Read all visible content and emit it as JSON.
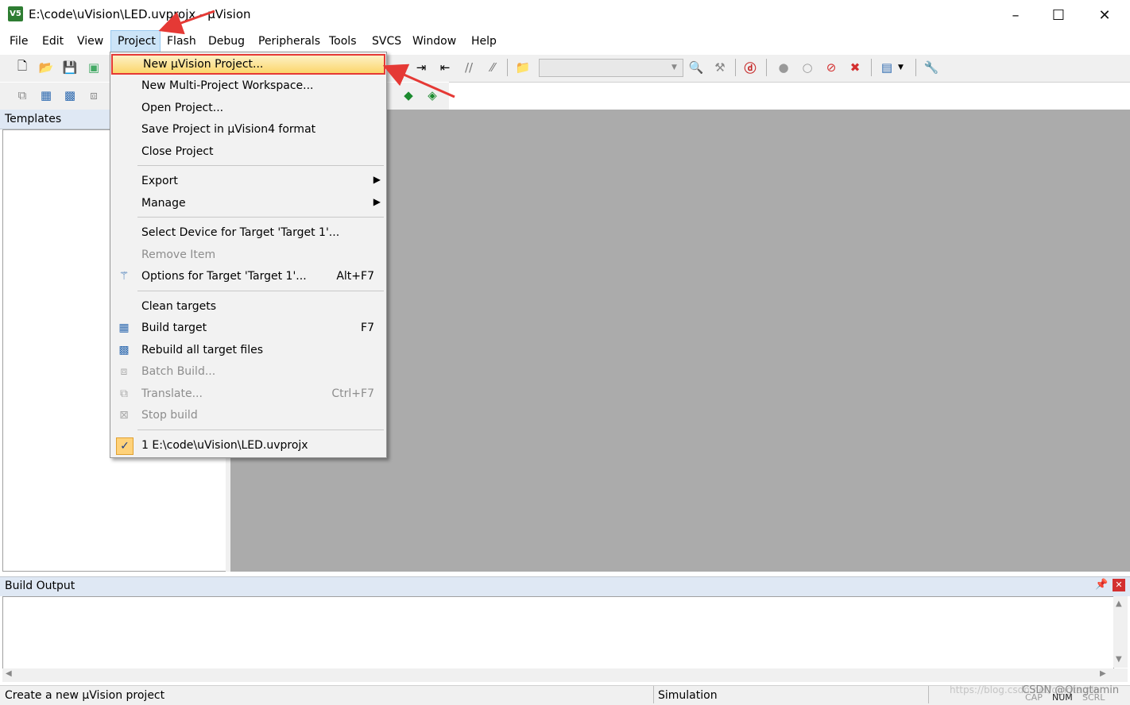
{
  "window": {
    "title": "E:\\code\\uVision\\LED.uvprojx - µVision",
    "app_icon_text": "V5",
    "minimize": "–",
    "maximize": "☐",
    "close": "✕"
  },
  "menubar": {
    "items": [
      "File",
      "Edit",
      "View",
      "Project",
      "Flash",
      "Debug",
      "Peripherals",
      "Tools",
      "SVCS",
      "Window",
      "Help"
    ],
    "active": "Project"
  },
  "project_menu": {
    "new_project": "New µVision Project...",
    "new_workspace": "New Multi-Project Workspace...",
    "open_project": "Open Project...",
    "save_project": "Save Project in µVision4 format",
    "close_project": "Close Project",
    "export": "Export",
    "manage": "Manage",
    "select_device": "Select Device for Target 'Target 1'...",
    "remove_item": "Remove Item",
    "options_target": "Options for Target 'Target 1'...",
    "options_shortcut": "Alt+F7",
    "clean_targets": "Clean targets",
    "build_target": "Build target",
    "build_shortcut": "F7",
    "rebuild_all": "Rebuild all target files",
    "batch_build": "Batch Build...",
    "translate": "Translate...",
    "translate_shortcut": "Ctrl+F7",
    "stop_build": "Stop build",
    "recent_1": "1 E:\\code\\uVision\\LED.uvprojx"
  },
  "panels": {
    "templates_title": "Templates",
    "build_output_title": "Build Output"
  },
  "statusbar": {
    "message": "Create a new µVision project",
    "mode": "Simulation",
    "watermark": "https://blog.csdn.net/qingtamin",
    "csdn": "CSDN @Qingtamin",
    "indicators": [
      "CAP",
      "NUM",
      "SCRL"
    ]
  },
  "accent_color": "#e53935"
}
